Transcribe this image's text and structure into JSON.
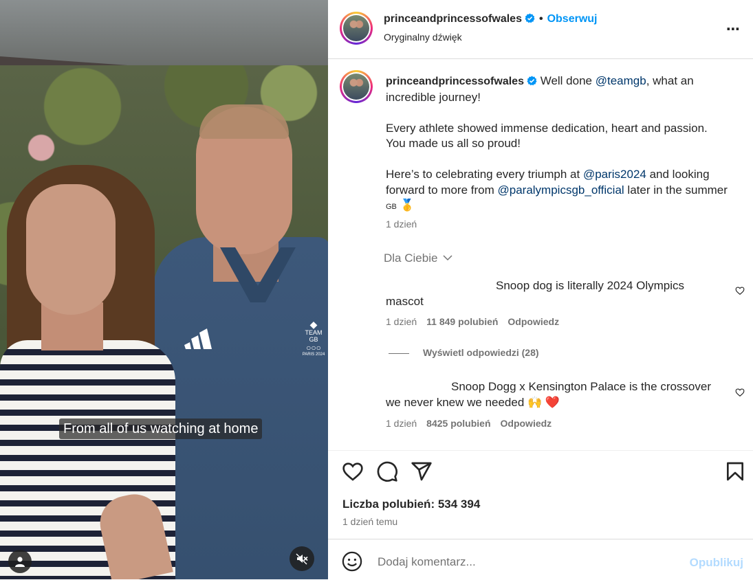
{
  "video": {
    "caption": "From all of us watching at home",
    "shirt_text_team": "TEAM GB",
    "shirt_text_paris": "PARIS 2024"
  },
  "header": {
    "username": "princeandprincessofwales",
    "separator": "•",
    "follow_label": "Obserwuj",
    "audio_label": "Oryginalny dźwięk",
    "more_icon": "⋯"
  },
  "post": {
    "username": "princeandprincessofwales",
    "caption_parts": {
      "p1a": "Well done ",
      "mention1": "@teamgb",
      "p1b": ", what an incredible journey!",
      "p2": "Every athlete showed immense dedication, heart and passion. You made us all so proud!",
      "p3a": "Here’s to celebrating every triumph at ",
      "mention2": "@paris2024",
      "p3b": " and looking forward to more from ",
      "mention3": "@paralympicsgb_official",
      "p3c": " later in the summer ",
      "flag": "GB",
      "medal": "🥇"
    },
    "time": "1 dzień",
    "for_you_label": "Dla Ciebie"
  },
  "comments": [
    {
      "text": "Snoop dog is literally 2024 Olympics mascot",
      "time": "1 dzień",
      "likes": "11 849 polubień",
      "reply": "Odpowiedz"
    },
    {
      "text": "Snoop Dogg x Kensington Palace is the crossover we never knew we needed 🙌 ❤️",
      "time": "1 dzień",
      "likes": "8425 polubień",
      "reply": "Odpowiedz"
    }
  ],
  "view_replies": "Wyświetl odpowiedzi (28)",
  "footer": {
    "likes_label": "Liczba polubień: 534 394",
    "posted_ago": "1 dzień temu",
    "comment_placeholder": "Dodaj komentarz...",
    "publish_label": "Opublikuj"
  },
  "colors": {
    "accent": "#0095f6",
    "mention": "#00376b",
    "muted": "#737373",
    "publish_disabled": "#b3dbff"
  }
}
